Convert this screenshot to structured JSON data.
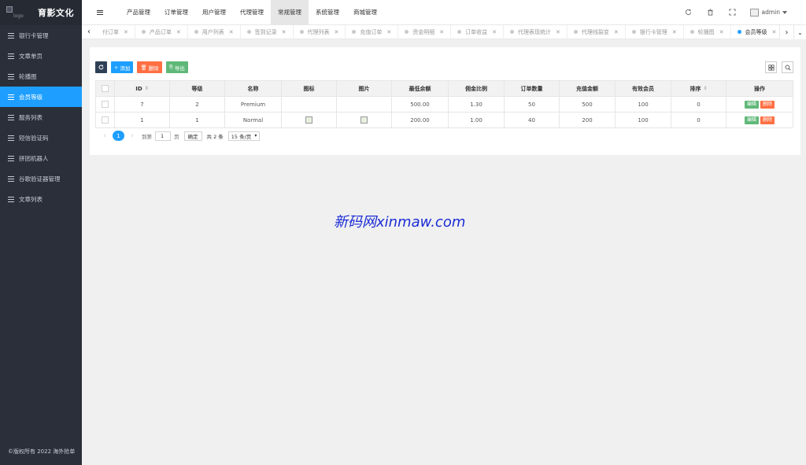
{
  "sidebar": {
    "logo_alt": "logo",
    "brand": "育影文化",
    "items": [
      {
        "label": "银行卡管理"
      },
      {
        "label": "文章单页"
      },
      {
        "label": "轮播图"
      },
      {
        "label": "会员等级",
        "active": true
      },
      {
        "label": "服务列表"
      },
      {
        "label": "短信验证码"
      },
      {
        "label": "拼团机器人"
      },
      {
        "label": "谷歌验证器管理"
      },
      {
        "label": "文章列表"
      }
    ],
    "footer": "©版权所有 2022 海外抢单"
  },
  "header": {
    "nav": [
      {
        "label": "产品管理"
      },
      {
        "label": "订单管理"
      },
      {
        "label": "用户管理"
      },
      {
        "label": "代理管理"
      },
      {
        "label": "常规管理",
        "active": true
      },
      {
        "label": "系统管理"
      },
      {
        "label": "商城管理"
      }
    ],
    "icons": [
      "refresh-icon",
      "trash-icon",
      "fullscreen-icon"
    ],
    "user": "admin"
  },
  "tabs": [
    {
      "label": "付订单"
    },
    {
      "label": "产品订单"
    },
    {
      "label": "用户列表"
    },
    {
      "label": "签到记录"
    },
    {
      "label": "代理列表"
    },
    {
      "label": "充值订单"
    },
    {
      "label": "资金明细"
    },
    {
      "label": "订单收益"
    },
    {
      "label": "代理表现统计"
    },
    {
      "label": "代理线裂变"
    },
    {
      "label": "银行卡管理"
    },
    {
      "label": "轮播图"
    },
    {
      "label": "会员等级",
      "active": true
    }
  ],
  "toolbar": {
    "add": "添加",
    "delete": "删除",
    "export": "导出"
  },
  "table": {
    "columns": [
      "ID",
      "等级",
      "名称",
      "图标",
      "图片",
      "最低余额",
      "佣金比例",
      "订单数量",
      "充值金额",
      "有效会员",
      "排序",
      "操作"
    ],
    "rows": [
      {
        "id": "7",
        "level": "2",
        "name": "Premium",
        "icon": false,
        "image": false,
        "min_balance": "500.00",
        "commission": "1.30",
        "orders": "50",
        "recharge": "500",
        "valid_members": "100",
        "sort": "0"
      },
      {
        "id": "1",
        "level": "1",
        "name": "Normal",
        "icon": true,
        "image": true,
        "min_balance": "200.00",
        "commission": "1.00",
        "orders": "40",
        "recharge": "200",
        "valid_members": "100",
        "sort": "0"
      }
    ],
    "edit_label": "编辑",
    "delete_label": "删除"
  },
  "pager": {
    "current": "1",
    "goto_label": "到第",
    "goto_value": "1",
    "page_unit": "页",
    "confirm": "确定",
    "total": "共 2 条",
    "per_page": "15 条/页"
  },
  "watermark": "新码网xinmaw.com",
  "colors": {
    "sidebar_bg": "#2a2f3a",
    "accent": "#1e9fff",
    "success": "#5fb878",
    "danger": "#ff5722"
  }
}
